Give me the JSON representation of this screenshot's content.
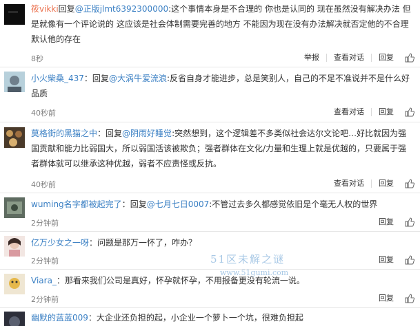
{
  "reply_prefix": "回复",
  "actions": {
    "report": "举报",
    "view_conversation": "查看对话",
    "reply": "回复"
  },
  "comments": [
    {
      "user": "筱vikki",
      "target": "@正版jlmt6392300000",
      "text": ":这个事情本身是不合理的 你也是认同的 现在虽然没有解决办法 但是就像有一个评论说的 这应该是社会体制需要完善的地方 不能因为现在没有办法解决就否定他的不合理 默认他的存在",
      "time": "8秒"
    },
    {
      "user": "小火柴桑_437",
      "target": "@大涡牛爱流浪",
      "text": ":反省自身才能进步，总是笑别人，自己的不足不准说并不是什么好品质",
      "time": "40秒前"
    },
    {
      "user": "莫格街的黑猫之中",
      "target": "@阴雨好睡觉",
      "text": ":突然想到，这个逻辑差不多类似社会达尔文论吧…好比就因为强国贡献和能力比弱国大，所以弱国活该被欺负；强者群体在文化/力量和生理上就是优越的，只要属于强者群体就可以继承这种优越，弱者不应责怪或反抗。",
      "time": "40秒前"
    },
    {
      "user": "wuming名字都被起完了",
      "target": "@七月七日0007",
      "text": ":不管过去多久都感觉依旧是个毫无人权的世界",
      "time": "2分钟前"
    },
    {
      "user": "亿万少女之一呀",
      "target": "",
      "text": "：问题是那万一怀了，咋办？",
      "time": "2分钟前"
    },
    {
      "user": "Viara_",
      "target": "",
      "text": "：那看来我们公司是真好，怀孕就怀孕，不用报备更没有轮流一说。",
      "time": "2分钟前"
    },
    {
      "user": "幽默的蓝蓝009",
      "target": "",
      "text": "：大企业还负担的起，小企业一个萝卜一个坑，很难负担起",
      "time": ""
    }
  ],
  "watermark": {
    "line1": "51区未解之谜",
    "line2": "www.51gumi.com"
  },
  "colors": {
    "nickname": "#eb7350",
    "mention": "#3b80c4",
    "meta": "#808080",
    "divider": "#e6e6e6"
  }
}
